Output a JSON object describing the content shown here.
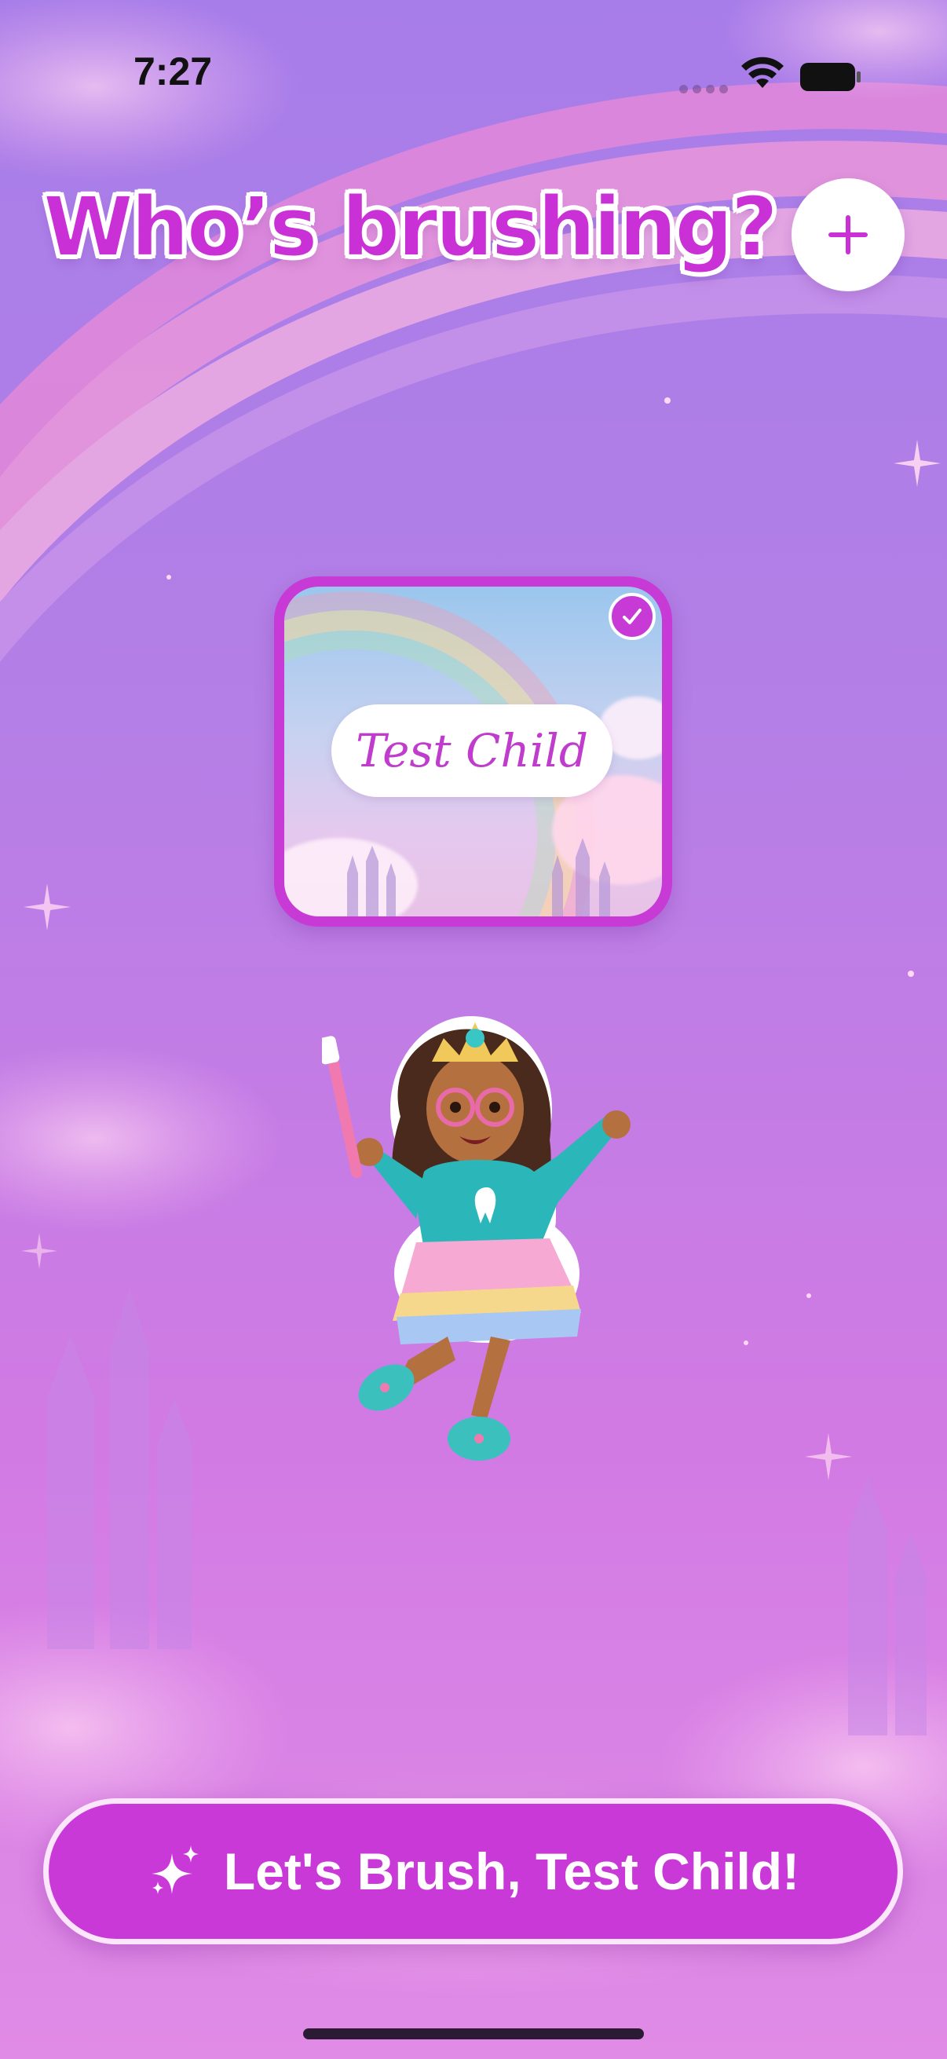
{
  "status_bar": {
    "time": "7:27"
  },
  "header": {
    "title": "Who’s brushing?",
    "add_button_icon": "plus-icon"
  },
  "profiles": [
    {
      "name": "Test Child",
      "selected": true
    }
  ],
  "cta": {
    "label": "Let's Brush, Test Child!",
    "icon": "sparkles-icon"
  },
  "colors": {
    "accent": "#c930d6",
    "background_top": "#a77de9",
    "background_bottom": "#e08be6"
  }
}
